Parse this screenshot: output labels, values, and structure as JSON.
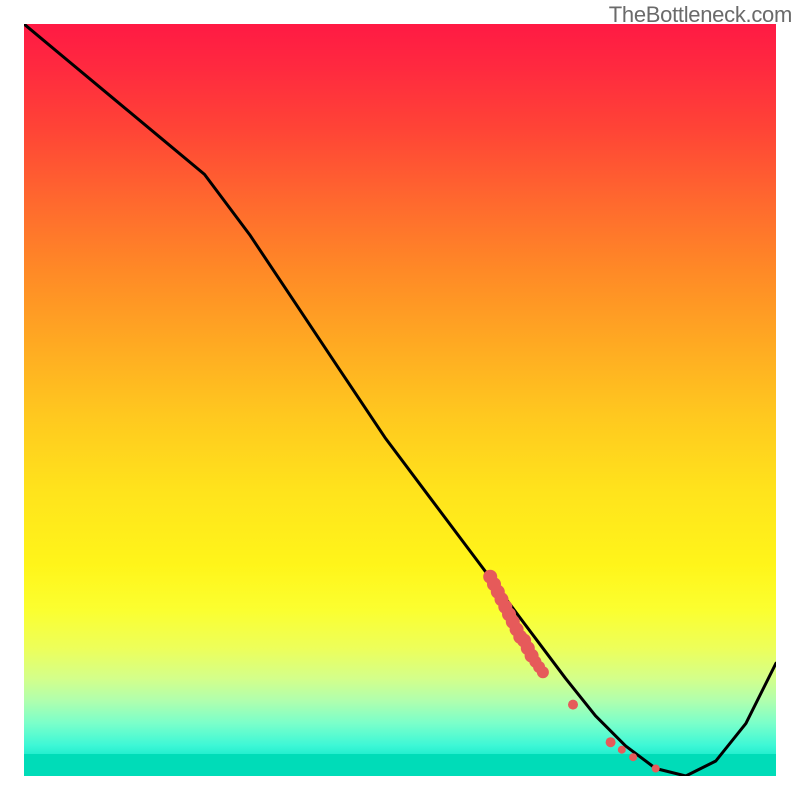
{
  "watermark": "TheBottleneck.com",
  "colors": {
    "curve": "#000000",
    "marker": "#e65a5a",
    "gradient_top": "#ff1a44",
    "gradient_bottom": "#00dcb8"
  },
  "chart_data": {
    "type": "line",
    "title": "",
    "xlabel": "",
    "ylabel": "",
    "xlim": [
      0,
      100
    ],
    "ylim": [
      0,
      100
    ],
    "grid": false,
    "series": [
      {
        "name": "bottleneck-curve",
        "x": [
          0,
          6,
          12,
          18,
          24,
          30,
          36,
          42,
          48,
          54,
          60,
          66,
          72,
          76,
          80,
          84,
          88,
          92,
          96,
          100
        ],
        "values": [
          100,
          95,
          90,
          85,
          80,
          72,
          63,
          54,
          45,
          37,
          29,
          21,
          13,
          8,
          4,
          1,
          0,
          2,
          7,
          15
        ]
      }
    ],
    "markers": [
      {
        "x": 62.0,
        "y": 26.5,
        "size": 7
      },
      {
        "x": 62.5,
        "y": 25.5,
        "size": 7
      },
      {
        "x": 63.0,
        "y": 24.5,
        "size": 7
      },
      {
        "x": 63.5,
        "y": 23.5,
        "size": 7
      },
      {
        "x": 64.0,
        "y": 22.5,
        "size": 7
      },
      {
        "x": 64.5,
        "y": 21.5,
        "size": 7
      },
      {
        "x": 65.0,
        "y": 20.5,
        "size": 7
      },
      {
        "x": 65.5,
        "y": 19.5,
        "size": 7
      },
      {
        "x": 66.0,
        "y": 18.5,
        "size": 7
      },
      {
        "x": 66.5,
        "y": 18.0,
        "size": 7
      },
      {
        "x": 67.0,
        "y": 17.0,
        "size": 7
      },
      {
        "x": 67.5,
        "y": 16.0,
        "size": 7
      },
      {
        "x": 68.0,
        "y": 15.2,
        "size": 6
      },
      {
        "x": 68.5,
        "y": 14.5,
        "size": 6
      },
      {
        "x": 69.0,
        "y": 13.8,
        "size": 6
      },
      {
        "x": 73.0,
        "y": 9.5,
        "size": 5
      },
      {
        "x": 78.0,
        "y": 4.5,
        "size": 5
      },
      {
        "x": 79.5,
        "y": 3.5,
        "size": 4
      },
      {
        "x": 81.0,
        "y": 2.5,
        "size": 4
      },
      {
        "x": 84.0,
        "y": 1.0,
        "size": 4
      }
    ]
  }
}
